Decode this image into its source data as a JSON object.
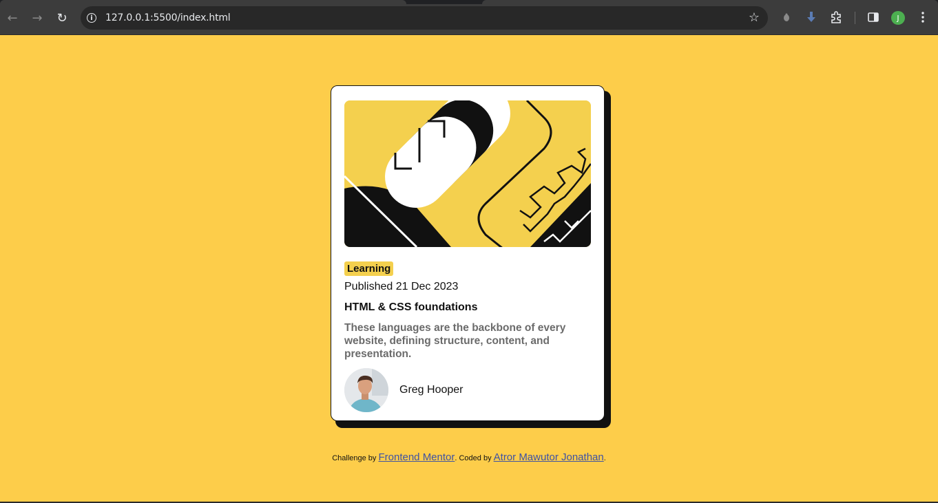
{
  "browser": {
    "url": "127.0.0.1:5500/index.html",
    "profile_initial": "J"
  },
  "card": {
    "category": "Learning",
    "published": "Published 21 Dec 2023",
    "title": "HTML & CSS foundations",
    "description": "These languages are the backbone of every website, defining structure, content, and presentation.",
    "author": "Greg Hooper"
  },
  "attribution": {
    "prefix": "Challenge by ",
    "challenge_link": "Frontend Mentor",
    "middle": ". Coded by ",
    "coder_link": "Atror Mawutor Jonathan",
    "suffix": "."
  },
  "colors": {
    "page_background": "#fdcd4a",
    "accent_yellow": "#f4d04e",
    "ink": "#111111",
    "link": "#3e52a3"
  },
  "icons": {
    "back": "back-arrow-icon",
    "forward": "forward-arrow-icon",
    "reload": "reload-icon",
    "site_info": "info-icon",
    "bookmark": "star-icon",
    "extensions": "puzzle-icon",
    "sidebar": "side-panel-icon",
    "menu": "kebab-menu-icon"
  }
}
